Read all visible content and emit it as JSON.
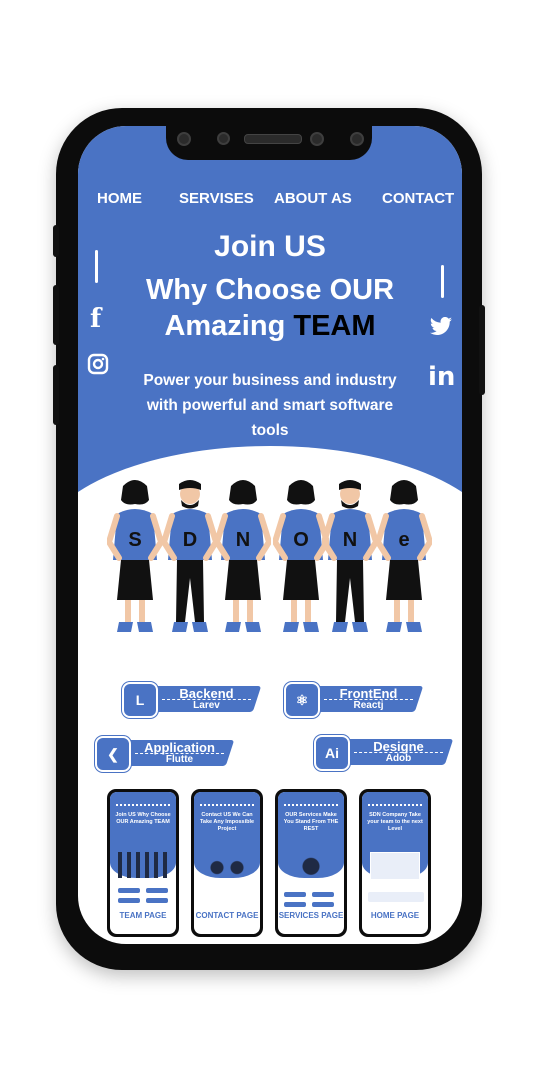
{
  "nav": {
    "items": [
      "HOME",
      "SERVISES",
      "ABOUT AS",
      "CONTACT"
    ]
  },
  "hero": {
    "line1": "Join US",
    "line2": "Why Choose OUR",
    "line3a": "Amazing ",
    "line3b": "TEAM",
    "description": "Power your business and industry with powerful and smart software tools"
  },
  "social": {
    "left": [
      "facebook-icon",
      "instagram-icon"
    ],
    "right": [
      "twitter-icon",
      "linkedin-icon"
    ]
  },
  "team_shirts": [
    "S",
    "D",
    "N",
    "O",
    "N",
    "e"
  ],
  "services": [
    {
      "title": "Backend",
      "subtitle": "Larev",
      "icon": "laravel-icon"
    },
    {
      "title": "FrontEnd",
      "subtitle": "Reactj",
      "icon": "react-icon"
    },
    {
      "title": "Application",
      "subtitle": "Flutte",
      "icon": "flutter-icon"
    },
    {
      "title": "Designe",
      "subtitle": "Adob",
      "icon": "adobe-icon"
    }
  ],
  "pages": [
    {
      "label": "TEAM PAGE",
      "heading": "Join US Why Choose OUR Amazing TEAM"
    },
    {
      "label": "CONTACT PAGE",
      "heading": "Contact US We Can Take Any Impossible Project"
    },
    {
      "label": "SERVICES PAGE",
      "heading": "OUR Services Make You Stand From THE REST"
    },
    {
      "label": "HOME PAGE",
      "heading": "SDN Company Take your team to the next Level"
    }
  ],
  "colors": {
    "accent": "#4a73c4",
    "dark": "#0c0c0c",
    "white": "#ffffff"
  }
}
